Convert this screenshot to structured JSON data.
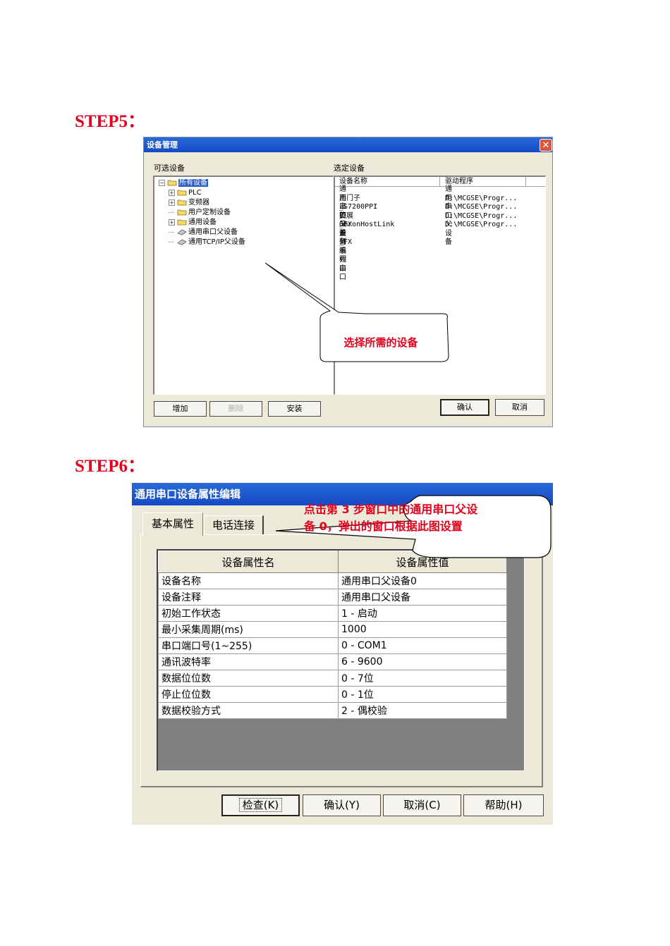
{
  "step5": {
    "label": "STEP5：",
    "dialog": {
      "title": "设备管理",
      "left_group": "可选设备",
      "right_group": "选定设备",
      "tree": [
        {
          "label": "所有设备",
          "level": 0,
          "expander": "⊟",
          "selected": true
        },
        {
          "label": "PLC",
          "level": 1,
          "expander": "+"
        },
        {
          "label": "变频器",
          "level": 1,
          "expander": "+"
        },
        {
          "label": "用户定制设备",
          "level": 1,
          "expander": ""
        },
        {
          "label": "通用设备",
          "level": 1,
          "expander": "+"
        },
        {
          "label": "通用串口父设备",
          "level": 1,
          "expander": ""
        },
        {
          "label": "通用TCP/IP父设备",
          "level": 1,
          "expander": ""
        }
      ],
      "columns": [
        "设备名称",
        "驱动程序"
      ],
      "rows": [
        [
          "通用串口父设备",
          "通用串口父设备"
        ],
        [
          "西门子_S7200PPI",
          "D:\\MCGSE\\Progr..."
        ],
        [
          "三菱_FX系列编程口",
          "D:\\MCGSE\\Progr..."
        ],
        [
          "扩展OmronHostLink",
          "D:\\MCGSE\\Progr..."
        ],
        [
          "三菱_FX系列串口",
          "D:\\MCGSE\\Progr..."
        ]
      ],
      "buttons": {
        "add": "增加",
        "delete": "删除",
        "install": "安装",
        "ok": "确认",
        "cancel": "取消"
      },
      "callout": "选择所需的设备"
    }
  },
  "step6": {
    "label": "STEP6：",
    "dialog": {
      "title": "通用串口设备属性编辑",
      "tabs": [
        "基本属性",
        "电话连接"
      ],
      "callout": [
        "点击第 3 步窗口中的通用串口父设",
        "备 0，弹出的窗口根据此图设置"
      ],
      "header": [
        "设备属性名",
        "设备属性值"
      ],
      "rows": [
        [
          "设备名称",
          "通用串口父设备0"
        ],
        [
          "设备注释",
          "通用串口父设备"
        ],
        [
          "初始工作状态",
          "1 - 启动"
        ],
        [
          "最小采集周期(ms)",
          "1000"
        ],
        [
          "串口端口号(1~255)",
          "0 - COM1"
        ],
        [
          "通讯波特率",
          "6 - 9600"
        ],
        [
          "数据位位数",
          "0 - 7位"
        ],
        [
          "停止位位数",
          "0 - 1位"
        ],
        [
          "数据校验方式",
          "2 - 偶校验"
        ]
      ],
      "buttons": {
        "check": "检查(K)",
        "ok": "确认(Y)",
        "cancel": "取消(C)",
        "help": "帮助(H)"
      }
    }
  }
}
